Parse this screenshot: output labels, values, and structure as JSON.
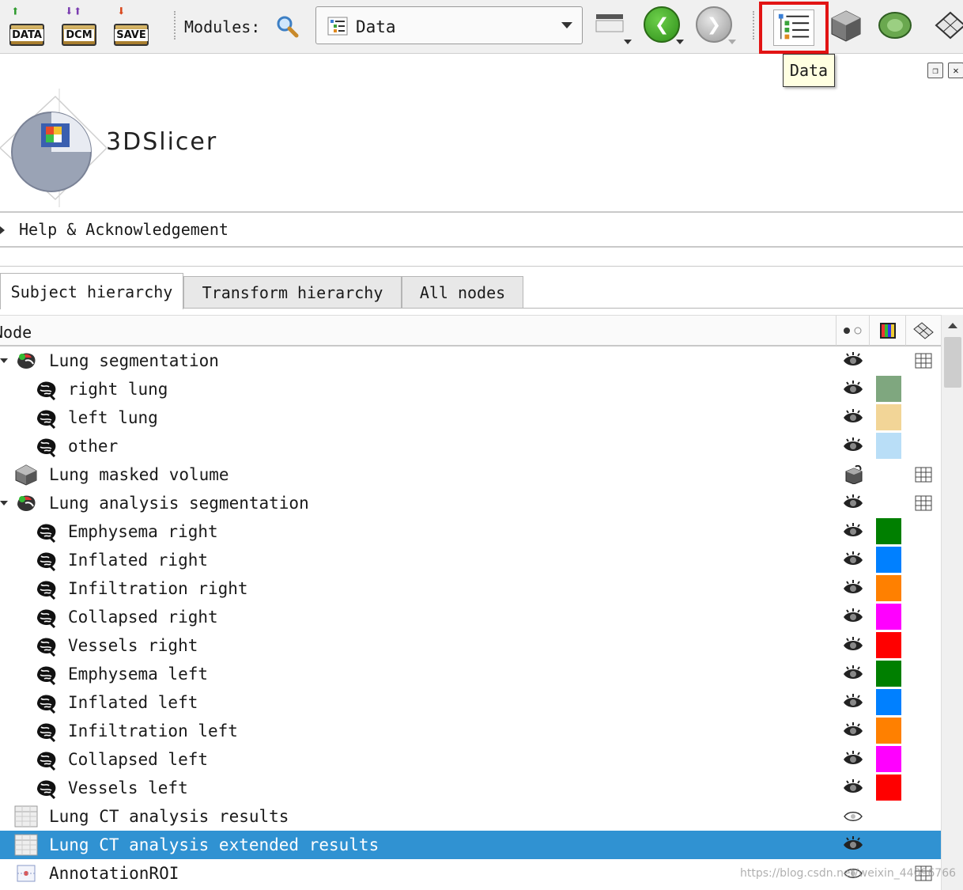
{
  "toolbar": {
    "data_button_label": "DATA",
    "dcm_button_label": "DCM",
    "save_button_label": "SAVE",
    "modules_label": "Modules:",
    "module_selector_value": "Data",
    "tooltip_text": "Data",
    "highlight_color": "#e21414"
  },
  "panel": {
    "logo_text": "3DSlicer",
    "help_section_label": "Help & Acknowledgement"
  },
  "tabs": [
    {
      "label": "Subject hierarchy",
      "active": true
    },
    {
      "label": "Transform hierarchy",
      "active": false
    },
    {
      "label": "All nodes",
      "active": false
    }
  ],
  "tree": {
    "header_node_label": "Node",
    "header_icons": [
      "visibility-column-icon",
      "color-column-icon",
      "transform-column-icon"
    ],
    "rows": [
      {
        "label": "Lung segmentation",
        "icon": "segmentation-icon",
        "expanded": true,
        "vis": "eye-icon",
        "grid": true
      },
      {
        "label": "right lung",
        "icon": "segment-brain-icon",
        "vis": "eye-icon",
        "color": "#7fa77f"
      },
      {
        "label": "left lung",
        "icon": "segment-brain-icon",
        "vis": "eye-icon",
        "color": "#f2d597"
      },
      {
        "label": "other",
        "icon": "segment-brain-icon",
        "vis": "eye-icon",
        "color": "#b9def7"
      },
      {
        "label": "Lung masked volume",
        "icon": "volume-cube-icon",
        "vis": "volume-visibility-icon",
        "grid": true
      },
      {
        "label": "Lung analysis segmentation",
        "icon": "segmentation-icon",
        "expanded": true,
        "vis": "eye-icon",
        "grid": true
      },
      {
        "label": "Emphysema right",
        "icon": "segment-brain-icon",
        "vis": "eye-icon",
        "color": "#007f00"
      },
      {
        "label": "Inflated right",
        "icon": "segment-brain-icon",
        "vis": "eye-icon",
        "color": "#0080ff"
      },
      {
        "label": "Infiltration right",
        "icon": "segment-brain-icon",
        "vis": "eye-icon",
        "color": "#ff8000"
      },
      {
        "label": "Collapsed right",
        "icon": "segment-brain-icon",
        "vis": "eye-icon",
        "color": "#ff00ff"
      },
      {
        "label": "Vessels right",
        "icon": "segment-brain-icon",
        "vis": "eye-icon",
        "color": "#ff0000"
      },
      {
        "label": "Emphysema left",
        "icon": "segment-brain-icon",
        "vis": "eye-icon",
        "color": "#007f00"
      },
      {
        "label": "Inflated left",
        "icon": "segment-brain-icon",
        "vis": "eye-icon",
        "color": "#0080ff"
      },
      {
        "label": "Infiltration left",
        "icon": "segment-brain-icon",
        "vis": "eye-icon",
        "color": "#ff8000"
      },
      {
        "label": "Collapsed left",
        "icon": "segment-brain-icon",
        "vis": "eye-icon",
        "color": "#ff00ff"
      },
      {
        "label": "Vessels left",
        "icon": "segment-brain-icon",
        "vis": "eye-icon",
        "color": "#ff0000"
      },
      {
        "label": "Lung CT analysis results",
        "icon": "table-icon",
        "vis": "eye-closed-icon"
      },
      {
        "label": "Lung CT analysis extended results",
        "icon": "table-icon",
        "vis": "eye-icon",
        "selected": true
      },
      {
        "label": "AnnotationROI",
        "icon": "annotation-roi-icon",
        "vis": "eye-closed-icon",
        "grid": true
      }
    ]
  },
  "watermark": "https://blog.csdn.net/weixin_44096766"
}
